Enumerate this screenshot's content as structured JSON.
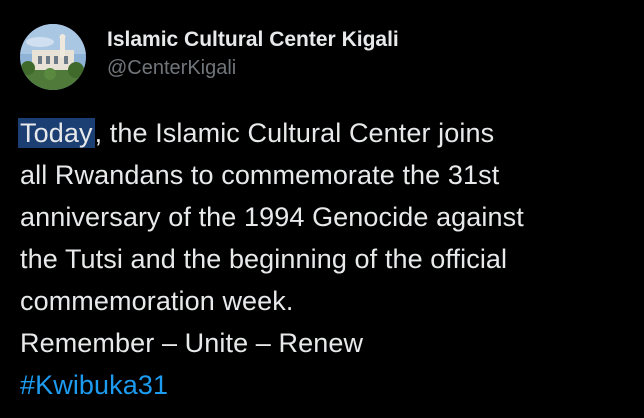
{
  "author": {
    "display_name": "Islamic Cultural Center Kigali",
    "handle": "@CenterKigali"
  },
  "post": {
    "highlighted_word": "Today",
    "line1_rest": ", the Islamic Cultural Center  joins",
    "line2": "all Rwandans to commemorate the 31st",
    "line3": "anniversary of the 1994 Genocide against",
    "line4": "the Tutsi and the beginning of the official",
    "line5": "commemoration week.",
    "line6": "Remember – Unite – Renew",
    "hashtag": "#Kwibuka31"
  },
  "colors": {
    "background": "#000000",
    "text": "#e7e9ea",
    "secondary_text": "#71767b",
    "link": "#1d9bf0",
    "selection": "#1c3f73"
  }
}
